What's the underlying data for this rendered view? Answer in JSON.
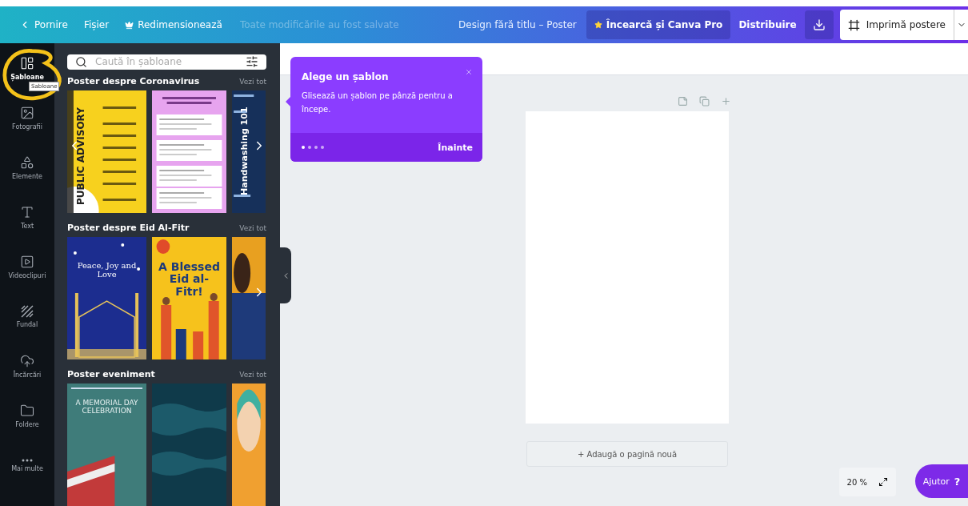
{
  "topbar": {
    "home": "Pornire",
    "file": "Fișier",
    "resize": "Redimensionează",
    "save_status": "Toate modificările au fost salvate",
    "design_title": "Design fără titlu – Poster",
    "try_pro": "Încearcă și Canva Pro",
    "share": "Distribuire",
    "print": "Imprimă postere"
  },
  "rail": [
    {
      "label": "Șabloane",
      "kind": "templates",
      "selected": true
    },
    {
      "label": "Fotografii",
      "kind": "photos",
      "selected": false
    },
    {
      "label": "Elemente",
      "kind": "elements",
      "selected": false
    },
    {
      "label": "Text",
      "kind": "text",
      "selected": false
    },
    {
      "label": "Videoclipuri",
      "kind": "videos",
      "selected": false
    },
    {
      "label": "Fundal",
      "kind": "background",
      "selected": false
    },
    {
      "label": "Încărcări",
      "kind": "uploads",
      "selected": false
    },
    {
      "label": "Foldere",
      "kind": "folders",
      "selected": false
    },
    {
      "label": "Mai multe",
      "kind": "more",
      "selected": false
    }
  ],
  "rail_tooltip": "Sabloane",
  "search": {
    "placeholder": "Caută în șabloane"
  },
  "sections": [
    {
      "title": "Poster despre Coronavirus",
      "see_all": "Vezi tot",
      "prev_arrow": true,
      "templates": [
        {
          "kind": "advisory",
          "text": "PUBLIC ADVISORY"
        },
        {
          "kind": "checklist"
        },
        {
          "kind": "handwash",
          "text": "Handwashing 101"
        }
      ]
    },
    {
      "title": "Poster despre Eid Al-Fitr",
      "see_all": "Vezi tot",
      "prev_arrow": false,
      "templates": [
        {
          "kind": "mosque",
          "text": "Peace, Joy and Love"
        },
        {
          "kind": "eid",
          "text": "A Blessed Eid al-Fitr!"
        },
        {
          "kind": "sunset"
        }
      ]
    },
    {
      "title": "Poster eveniment",
      "see_all": "Vezi tot",
      "prev_arrow": false,
      "templates": [
        {
          "kind": "memorial",
          "text": "A MEMORIAL DAY CELEBRATION"
        },
        {
          "kind": "sea"
        },
        {
          "kind": "portrait"
        }
      ]
    }
  ],
  "tour": {
    "title": "Alege un șablon",
    "body": "Glisează un șablon pe pânză pentru a începe.",
    "steps": [
      {
        "selected": true
      },
      {
        "selected": false
      },
      {
        "selected": false
      },
      {
        "selected": false
      }
    ],
    "next": "Înainte"
  },
  "add_page": "+ Adaugă o pagină nouă",
  "zoom": "20 %",
  "help": "Ajutor",
  "help_mark": "?"
}
